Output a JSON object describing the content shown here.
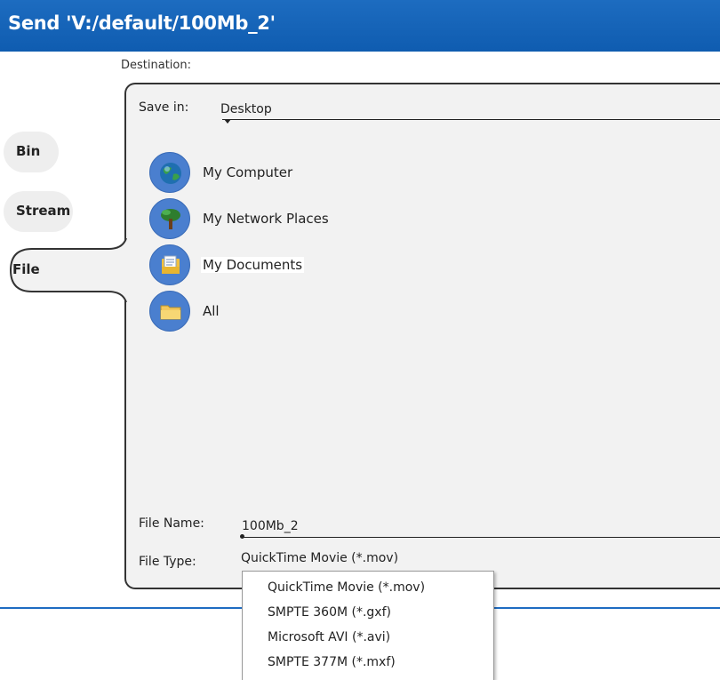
{
  "window": {
    "title": "Send 'V:/default/100Mb_2'"
  },
  "destination_label": "Destination:",
  "tabs": [
    {
      "label": "Bin",
      "selected": false
    },
    {
      "label": "Stream",
      "selected": false
    },
    {
      "label": "File",
      "selected": true
    }
  ],
  "save_in": {
    "label": "Save in:",
    "value": "Desktop"
  },
  "locations": [
    {
      "label": "My Computer",
      "icon": "globe-icon"
    },
    {
      "label": "My Network Places",
      "icon": "tree-icon"
    },
    {
      "label": "My Documents",
      "icon": "documents-icon"
    },
    {
      "label": "All",
      "icon": "folder-icon"
    }
  ],
  "file_name": {
    "label": "File Name:",
    "value": "100Mb_2"
  },
  "file_type": {
    "label": "File Type:",
    "value": "QuickTime Movie (*.mov)"
  },
  "file_type_options": [
    "QuickTime Movie (*.mov)",
    "SMPTE 360M (*.gxf)",
    "Microsoft AVI (*.avi)",
    "SMPTE 377M (*.mxf)"
  ],
  "colors": {
    "titlebar": "#1565c0",
    "accent": "#1e6cc2",
    "icon_bg": "#4a7fcf",
    "panel": "#f2f2f2"
  }
}
